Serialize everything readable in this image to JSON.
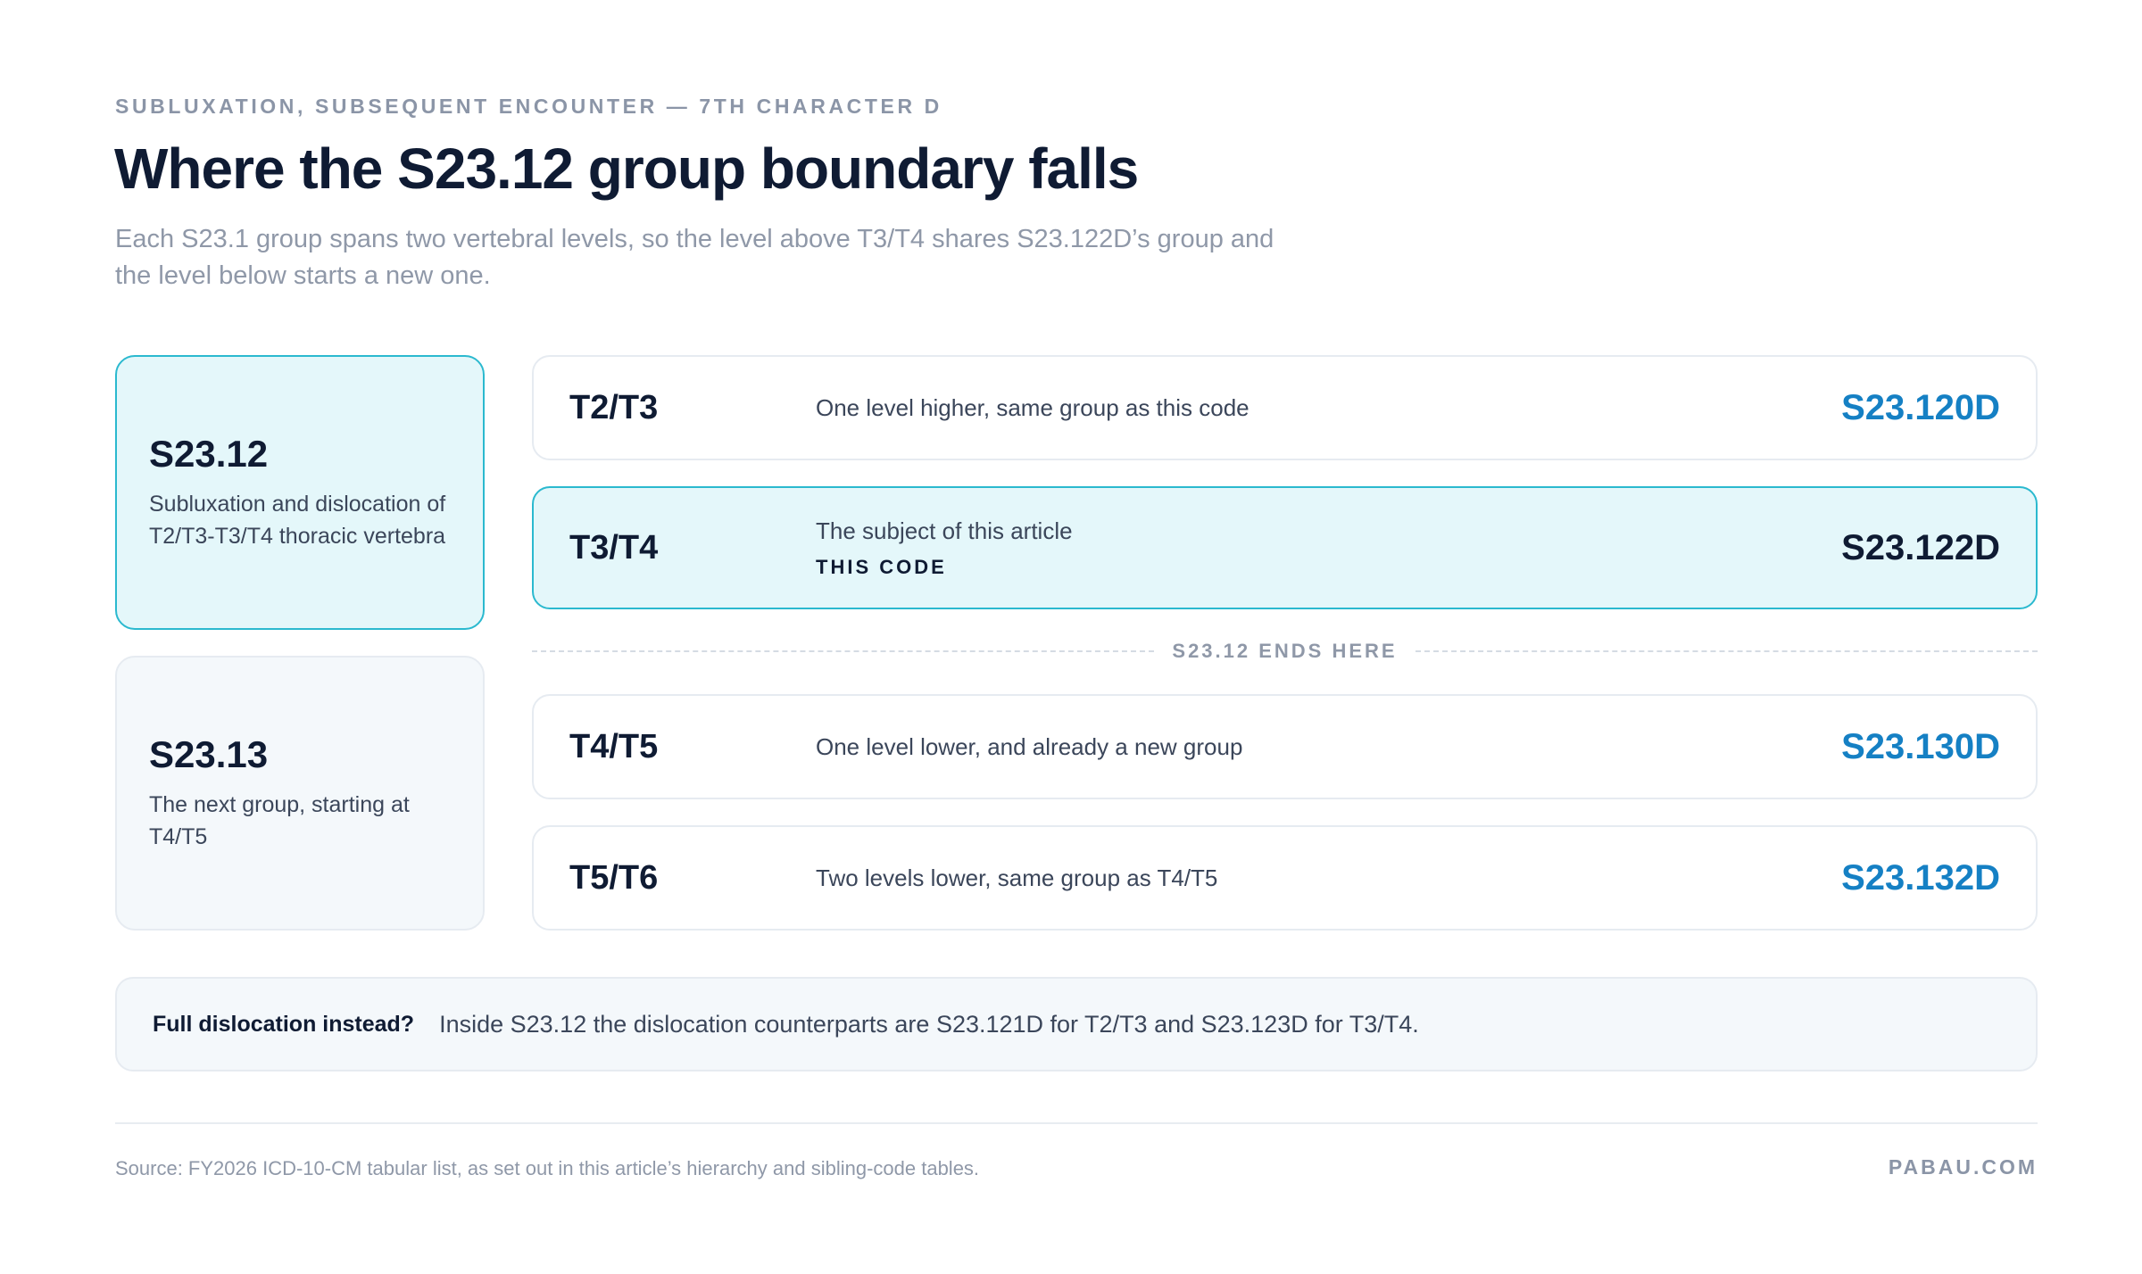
{
  "header": {
    "eyebrow": "SUBLUXATION, SUBSEQUENT ENCOUNTER — 7TH CHARACTER D",
    "title": "Where the S23.12 group boundary falls",
    "subtitle": "Each S23.1 group spans two vertebral levels, so the level above T3/T4 shares S23.122D’s group and the level below starts a new one."
  },
  "groups": [
    {
      "code": "S23.12",
      "description": "Subluxation and dislocation of T2/T3-T3/T4 thoracic vertebra",
      "active": true
    },
    {
      "code": "S23.13",
      "description": "The next group, starting at T4/T5",
      "active": false
    }
  ],
  "rows": [
    {
      "level": "T2/T3",
      "description": "One level higher, same group as this code",
      "code": "S23.120D"
    },
    {
      "level": "T3/T4",
      "description": "The subject of this article",
      "badge": "THIS CODE",
      "code": "S23.122D"
    },
    {
      "level": "T4/T5",
      "description": "One level lower, and already a new group",
      "code": "S23.130D"
    },
    {
      "level": "T5/T6",
      "description": "Two levels lower, same group as T4/T5",
      "code": "S23.132D"
    }
  ],
  "divider": {
    "label": "S23.12 ENDS HERE"
  },
  "note": {
    "label": "Full dislocation instead?",
    "text": "Inside S23.12 the dislocation counterparts are S23.121D for T2/T3 and S23.123D for T3/T4."
  },
  "footer": {
    "source": "Source: FY2026 ICD-10-CM tabular list, as set out in this article’s hierarchy and sibling-code tables.",
    "brand": "PABAU.COM"
  },
  "colors": {
    "accent": "#2bb9cf",
    "highlight_bg": "#e4f7fa",
    "code_blue": "#1580c4",
    "ink": "#0f1b33",
    "muted": "#8f98a8"
  }
}
